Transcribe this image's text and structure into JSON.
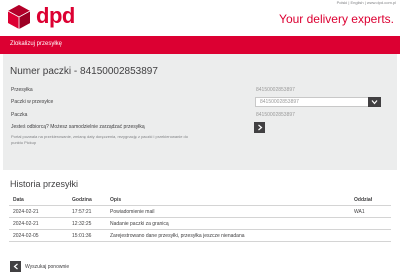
{
  "header": {
    "logo_text": "dpd",
    "toplinks": "Polski | English | www.dpd.com.pl",
    "tagline": "Your delivery experts."
  },
  "banner": {
    "label": "Zlokalizuj przesyłkę"
  },
  "parcel": {
    "title": "Numer paczki - 84150002853897",
    "fields": [
      {
        "label": "Przesyłka",
        "value": "84150002853897"
      },
      {
        "label": "Paczki w przesyłce",
        "value": "84150002853897"
      },
      {
        "label": "Paczka",
        "value": "84150002853897"
      }
    ],
    "manage_label": "Jesteś odbiorcą? Możesz samodzielnie zarządzać przesyłką",
    "manage_note": "Portal pozwala na przekierowanie, zmianę daty doręczenia, rezygnację z paczki i przekierowanie do punktu Pickup"
  },
  "history": {
    "title": "Historia przesyłki",
    "columns": [
      "Data",
      "Godzina",
      "Opis",
      "Oddział"
    ],
    "rows": [
      {
        "date": "2024-02-21",
        "time": "17:57:21",
        "desc": "Powiadomienie mail",
        "branch": "WA1"
      },
      {
        "date": "2024-02-21",
        "time": "12:32:25",
        "desc": "Nadanie paczki za granicą",
        "branch": ""
      },
      {
        "date": "2024-02-05",
        "time": "15:01:36",
        "desc": "Zarejestrowano dane przesyłki, przesyłka jeszcze nienadana",
        "branch": ""
      }
    ]
  },
  "back": {
    "label": "Wyszukaj ponownie"
  },
  "colors": {
    "brand": "#dc0032",
    "dark": "#414042",
    "panel": "#eceded"
  }
}
